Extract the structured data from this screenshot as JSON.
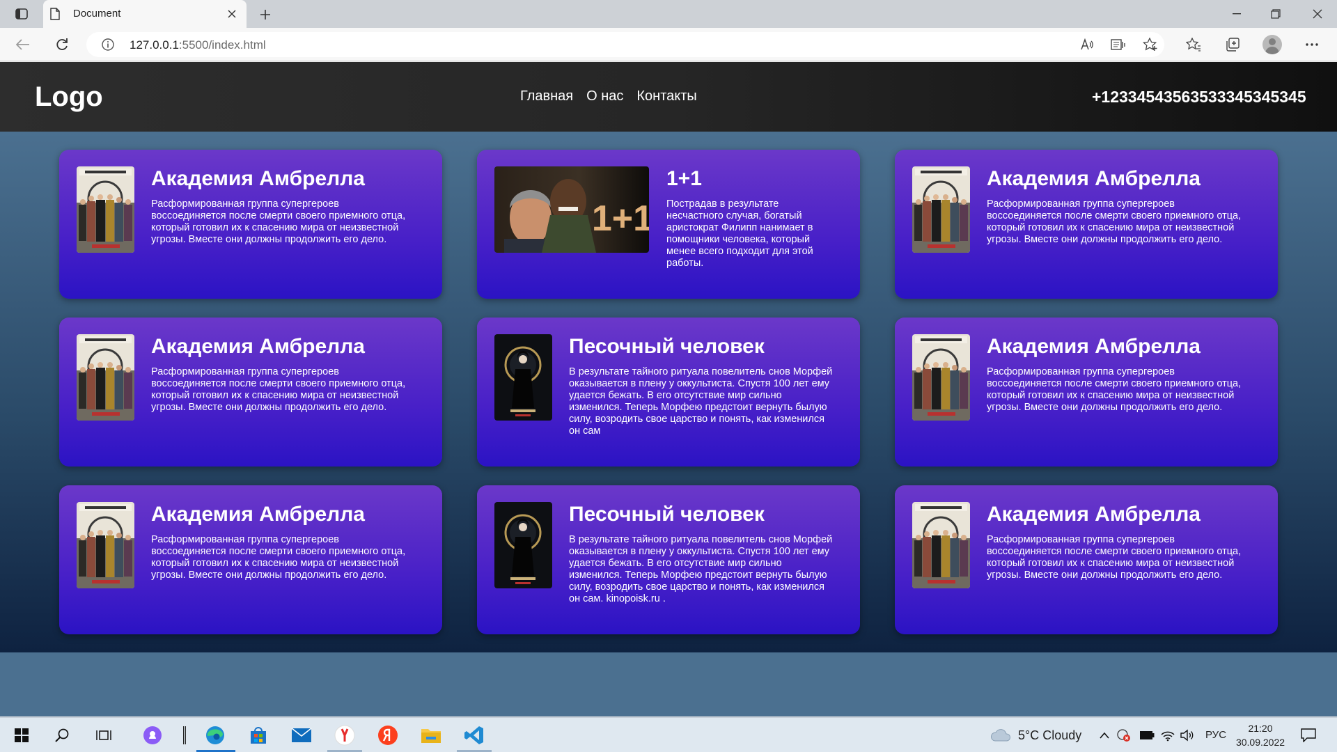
{
  "browser": {
    "tab_title": "Document",
    "url_host": "127.0.0.1",
    "url_rest": ":5500/index.html"
  },
  "site": {
    "logo": "Logo",
    "nav": [
      "Главная",
      "О нас",
      "Контакты"
    ],
    "phone": "+12334543563533345345345"
  },
  "cards": [
    {
      "title": "Академия Амбрелла",
      "poster": "umbrella-academy",
      "desc": "Расформированная группа супергероев воссоединяется после смерти своего приемного отца, который готовил их к спасению мира от неизвестной угрозы. Вместе они должны продолжить его дело."
    },
    {
      "title": "1+1",
      "poster": "intouchables",
      "desc": "Пострадав в результате несчастного случая, богатый аристократ Филипп нанимает в помощники человека, который менее всего подходит для этой работы."
    },
    {
      "title": "Академия Амбрелла",
      "poster": "umbrella-academy",
      "desc": "Расформированная группа супергероев воссоединяется после смерти своего приемного отца, который готовил их к спасению мира от неизвестной угрозы. Вместе они должны продолжить его дело."
    },
    {
      "title": "Академия Амбрелла",
      "poster": "umbrella-academy",
      "desc": "Расформированная группа супергероев воссоединяется после смерти своего приемного отца, который готовил их к спасению мира от неизвестной угрозы. Вместе они должны продолжить его дело."
    },
    {
      "title": "Песочный человек",
      "poster": "sandman",
      "desc": "В результате тайного ритуала повелитель снов Морфей оказывается в плену у оккультиста. Спустя 100 лет ему удается бежать. В его отсутствие мир сильно изменился. Теперь Морфею предстоит вернуть былую силу, возродить свое царство и понять, как изменился он сам"
    },
    {
      "title": "Академия Амбрелла",
      "poster": "umbrella-academy",
      "desc": "Расформированная группа супергероев воссоединяется после смерти своего приемного отца, который готовил их к спасению мира от неизвестной угрозы. Вместе они должны продолжить его дело."
    },
    {
      "title": "Академия Амбрелла",
      "poster": "umbrella-academy",
      "desc": "Расформированная группа супергероев воссоединяется после смерти своего приемного отца, который готовил их к спасению мира от неизвестной угрозы. Вместе они должны продолжить его дело."
    },
    {
      "title": "Песочный человек",
      "poster": "sandman",
      "desc": "В результате тайного ритуала повелитель снов Морфей оказывается в плену у оккультиста. Спустя 100 лет ему удается бежать. В его отсутствие мир сильно изменился. Теперь Морфею предстоит вернуть былую силу, возродить свое царство и понять, как изменился он сам. kinopoisk.ru ."
    },
    {
      "title": "Академия Амбрелла",
      "poster": "umbrella-academy",
      "desc": "Расформированная группа супергероев воссоединяется после смерти своего приемного отца, который готовил их к спасению мира от неизвестной угрозы. Вместе они должны продолжить его дело."
    }
  ],
  "taskbar": {
    "weather": "5°C  Cloudy",
    "lang": "РУС",
    "time": "21:20",
    "date": "30.09.2022"
  }
}
